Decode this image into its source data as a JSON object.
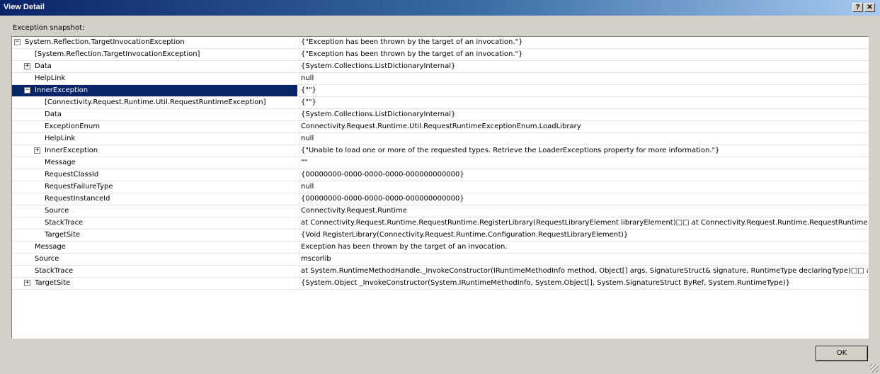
{
  "window": {
    "title": "View Detail",
    "help_button": "?",
    "close_button": "✕"
  },
  "snapshot_label": "Exception snapshot:",
  "ok_label": "OK",
  "rows": [
    {
      "indent": 0,
      "expander": "−",
      "name": "System.Reflection.TargetInvocationException",
      "value": "{\"Exception has been thrown by the target of an invocation.\"}"
    },
    {
      "indent": 1,
      "expander": "",
      "name": "[System.Reflection.TargetInvocationException]",
      "value": "{\"Exception has been thrown by the target of an invocation.\"}"
    },
    {
      "indent": 1,
      "expander": "+",
      "name": "Data",
      "value": "{System.Collections.ListDictionaryInternal}"
    },
    {
      "indent": 1,
      "expander": "",
      "name": "HelpLink",
      "value": "null"
    },
    {
      "indent": 1,
      "expander": "−",
      "name": "InnerException",
      "value": "{\"\"}",
      "selected": true
    },
    {
      "indent": 2,
      "expander": "",
      "name": "[Connectivity.Request.Runtime.Util.RequestRuntimeException]",
      "value": "{\"\"}"
    },
    {
      "indent": 2,
      "expander": "",
      "name": "Data",
      "value": "{System.Collections.ListDictionaryInternal}"
    },
    {
      "indent": 2,
      "expander": "",
      "name": "ExceptionEnum",
      "value": "Connectivity.Request.Runtime.Util.RequestRuntimeExceptionEnum.LoadLibrary"
    },
    {
      "indent": 2,
      "expander": "",
      "name": "HelpLink",
      "value": "null"
    },
    {
      "indent": 2,
      "expander": "+",
      "name": "InnerException",
      "value": "{\"Unable to load one or more of the requested types. Retrieve the LoaderExceptions property for more information.\"}"
    },
    {
      "indent": 2,
      "expander": "",
      "name": "Message",
      "value": "\"\""
    },
    {
      "indent": 2,
      "expander": "",
      "name": "RequestClassId",
      "value": "{00000000-0000-0000-0000-000000000000}"
    },
    {
      "indent": 2,
      "expander": "",
      "name": "RequestFailureType",
      "value": "null"
    },
    {
      "indent": 2,
      "expander": "",
      "name": "RequestInstanceId",
      "value": "{00000000-0000-0000-0000-000000000000}"
    },
    {
      "indent": 2,
      "expander": "",
      "name": "Source",
      "value": "Connectivity.Request.Runtime"
    },
    {
      "indent": 2,
      "expander": "",
      "name": "StackTrace",
      "value": "   at Connectivity.Request.Runtime.RequestRuntime.RegisterLibrary(RequestLibraryElement libraryElement)□□   at Connectivity.Request.Runtime.RequestRuntime.<"
    },
    {
      "indent": 2,
      "expander": "",
      "name": "TargetSite",
      "value": "{Void RegisterLibrary(Connectivity.Request.Runtime.Configuration.RequestLibraryElement)}"
    },
    {
      "indent": 1,
      "expander": "",
      "name": "Message",
      "value": "Exception has been thrown by the target of an invocation."
    },
    {
      "indent": 1,
      "expander": "",
      "name": "Source",
      "value": "mscorlib"
    },
    {
      "indent": 1,
      "expander": "",
      "name": "StackTrace",
      "value": "   at System.RuntimeMethodHandle._InvokeConstructor(IRuntimeMethodInfo method, Object[] args, SignatureStruct& signature, RuntimeType declaringType)□□   at"
    },
    {
      "indent": 1,
      "expander": "+",
      "name": "TargetSite",
      "value": "{System.Object _InvokeConstructor(System.IRuntimeMethodInfo, System.Object[], System.SignatureStruct ByRef, System.RuntimeType)}"
    }
  ]
}
